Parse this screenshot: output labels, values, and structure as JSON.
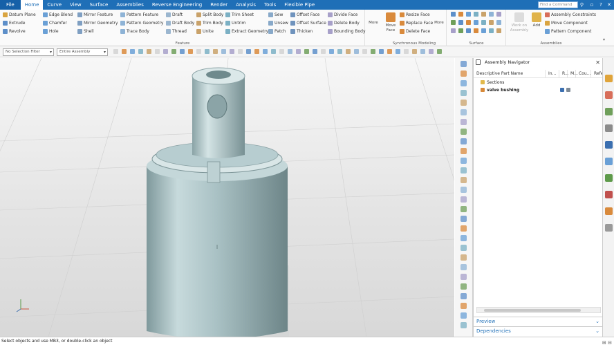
{
  "menu": {
    "tabs": [
      "File",
      "Home",
      "Curve",
      "View",
      "Surface",
      "Assemblies",
      "Reverse Engineering",
      "Render",
      "Analysis",
      "Tools",
      "Flexible Pipe"
    ],
    "active": "Home",
    "command_search_placeholder": "Find a Command"
  },
  "ribbon": {
    "feature": {
      "label": "Feature",
      "col1": [
        "Datum Plane",
        "Extrude",
        "Revolve"
      ],
      "col2": [
        "Edge Blend",
        "Chamfer",
        "Hole"
      ],
      "col3": [
        "Mirror Feature",
        "Mirror Geometry",
        "Shell"
      ],
      "col4": [
        "Pattern Feature",
        "Pattern Geometry",
        "Trace Body"
      ],
      "col5": [
        "Draft",
        "Draft Body",
        "Thread"
      ],
      "col6": [
        "Split Body",
        "Trim Body",
        "Unite"
      ],
      "col7": [
        "Trim Sheet",
        "Untrim",
        "Extract Geometry"
      ],
      "col8": [
        "Sew",
        "Unsew",
        "Patch"
      ],
      "col9": [
        "Offset Face",
        "Offset Surface",
        "Thicken"
      ],
      "col10": [
        "Divide Face",
        "Delete Body",
        "Bounding Body"
      ],
      "more": "More"
    },
    "sync": {
      "label": "Synchronous Modeling",
      "move_face": "Move Face",
      "items": [
        "Resize Face",
        "Replace Face",
        "Delete Face"
      ],
      "more": "More"
    },
    "surface": {
      "label": "Surface"
    },
    "assemblies": {
      "label": "Assemblies",
      "workon": "Work on Assembly",
      "add": "Add",
      "items": [
        "Assembly Constraints",
        "Move Component",
        "Pattern Component"
      ]
    }
  },
  "toolbar2": {
    "filter": "No Selection Filter",
    "scope": "Entire Assembly"
  },
  "navigator": {
    "title": "Assembly Navigator",
    "columns": [
      "Descriptive Part Name",
      "In...",
      "R...",
      "M...",
      "Cou...",
      "Refe"
    ],
    "rows": [
      {
        "label": "Sections"
      },
      {
        "label": "valve bushing"
      }
    ],
    "preview": "Preview",
    "dependencies": "Dependencies"
  },
  "status": {
    "message": "Select objects and use MB3, or double-click an object"
  },
  "colors": {
    "accent": "#1f6fb7",
    "part": "#a9c3c6"
  }
}
